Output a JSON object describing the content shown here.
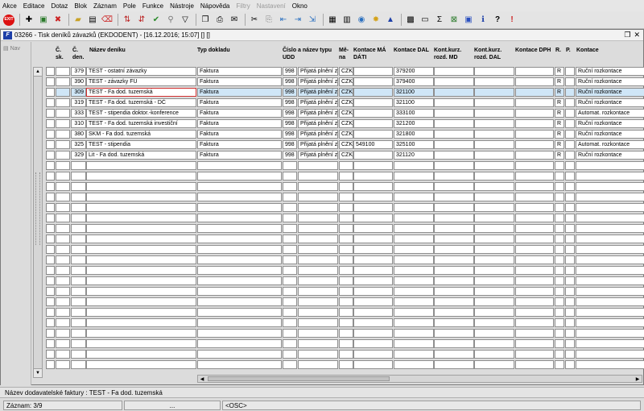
{
  "menu": [
    "Akce",
    "Editace",
    "Dotaz",
    "Blok",
    "Záznam",
    "Pole",
    "Funkce",
    "Nástroje",
    "Nápověda",
    "Filtry",
    "Nastavení",
    "Okno"
  ],
  "menu_disabled": [
    "Filtry",
    "Nastavení"
  ],
  "toolbar": {
    "exit_label": "EXIT"
  },
  "window": {
    "title": "03266 - Tisk deníků závazků (EKDODENT) - [16.12.2016; 15:07] [] []",
    "icon_letter": "F"
  },
  "nav": {
    "label": "Nav"
  },
  "columns": {
    "c1": "Č. sk.",
    "c2": "Č. den.",
    "name": "Název deníku",
    "type": "Typ dokladu",
    "num": "Číslo a název typu UDD",
    "cur": "Mě- na",
    "md": "Kontace MÁ DÁTI",
    "dal": "Kontace DAL",
    "kmd": "Kont.kurz. rozd. MD",
    "kdal": "Kont.kurz. rozd. DAL",
    "dph": "Kontace DPH",
    "r": "R.",
    "p": "P.",
    "kon": "Kontace"
  },
  "rows": [
    {
      "den": "379",
      "name": "TEST - ostatní závazky",
      "type": "Faktura",
      "num": "998",
      "udd": "Přijatá plnění z",
      "cur": "CZK",
      "md": "",
      "dal": "379200",
      "r": "R",
      "kon": "Ruční rozkontace"
    },
    {
      "den": "390",
      "name": "TEST - závazky FÚ",
      "type": "Faktura",
      "num": "998",
      "udd": "Přijatá plnění z",
      "cur": "CZK",
      "md": "",
      "dal": "379400",
      "r": "R",
      "kon": "Ruční rozkontace"
    },
    {
      "den": "309",
      "name": "TEST - Fa dod. tuzemská",
      "type": "Faktura",
      "num": "998",
      "udd": "Přijatá plnění z",
      "cur": "CZK",
      "md": "",
      "dal": "321100",
      "r": "R",
      "kon": "Ruční rozkontace"
    },
    {
      "den": "319",
      "name": "TEST - Fa dod. tuzemská - DČ",
      "type": "Faktura",
      "num": "998",
      "udd": "Přijatá plnění z",
      "cur": "CZK",
      "md": "",
      "dal": "321100",
      "r": "R",
      "kon": "Ruční rozkontace"
    },
    {
      "den": "333",
      "name": "TEST - stipendia doktor.-konference",
      "type": "Faktura",
      "num": "998",
      "udd": "Přijatá plnění z",
      "cur": "CZK",
      "md": "",
      "dal": "333100",
      "r": "R",
      "kon": "Automat. rozkontace"
    },
    {
      "den": "310",
      "name": "TEST - Fa dod. tuzemská investiční",
      "type": "Faktura",
      "num": "998",
      "udd": "Přijatá plnění z",
      "cur": "CZK",
      "md": "",
      "dal": "321200",
      "r": "R",
      "kon": "Ruční rozkontace"
    },
    {
      "den": "380",
      "name": "SKM - Fa dod. tuzemská",
      "type": "Faktura",
      "num": "998",
      "udd": "Přijatá plnění z",
      "cur": "CZK",
      "md": "",
      "dal": "321800",
      "r": "R",
      "kon": "Ruční rozkontace"
    },
    {
      "den": "325",
      "name": "TEST - stipendia",
      "type": "Faktura",
      "num": "998",
      "udd": "Přijatá plnění z",
      "cur": "CZK",
      "md": "549100",
      "dal": "325100",
      "r": "R",
      "kon": "Automat. rozkontace"
    },
    {
      "den": "329",
      "name": "Lit - Fa dod. tuzemská",
      "type": "Faktura",
      "num": "998",
      "udd": "Přijatá plnění z",
      "cur": "CZK",
      "md": "",
      "dal": "321120",
      "r": "R",
      "kon": "Ruční rozkontace"
    }
  ],
  "current_row": 2,
  "status": {
    "hint": "Název dodavatelské faktury : TEST - Fa dod. tuzemská",
    "record": "Záznam: 3/9",
    "dots": "...",
    "mode": "<OSC>"
  },
  "colors": {
    "selected_row": "#cfe6f7",
    "current_cell_border": "#d23030",
    "exit_bg": "#d11111",
    "window_icon": "#1d3fa8"
  }
}
